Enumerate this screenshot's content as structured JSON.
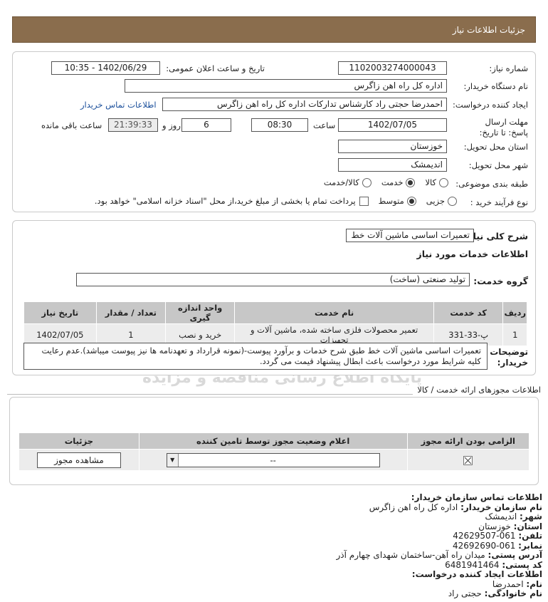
{
  "header": {
    "title": "جزئیات اطلاعات نیاز"
  },
  "need": {
    "number_label": "شماره نیاز:",
    "number": "1102003274000043",
    "announce_label": "تاریخ و ساعت اعلان عمومی:",
    "announce_value": "1402/06/29 - 10:35",
    "buyer_label": "نام دستگاه خریدار:",
    "buyer": "اداره کل راه اهن زاگرس",
    "creator_label": "ایجاد کننده درخواست:",
    "creator": "احمدرضا حجتی راد کارشناس تدارکات اداره کل راه اهن زاگرس",
    "contact_link": "اطلاعات تماس خریدار",
    "deadline_label": "مهلت ارسال پاسخ: تا تاریخ:",
    "deadline_date": "1402/07/05",
    "time_label": "ساعت",
    "deadline_time": "08:30",
    "days_value": "6",
    "days_label": "روز و",
    "remaining_time": "21:39:33",
    "remaining_label": "ساعت باقی مانده",
    "province_label": "استان محل تحویل:",
    "province": "خوزستان",
    "city_label": "شهر محل تحویل:",
    "city": "اندیمشک",
    "category_label": "طبقه بندی موضوعی:",
    "category_options": [
      "کالا",
      "خدمت",
      "کالا/خدمت"
    ],
    "category_selected": "خدمت",
    "process_label": "نوع فرآیند خرید :",
    "process_options": [
      "جزیی",
      "متوسط"
    ],
    "process_selected": "متوسط",
    "payment_note": "پرداخت تمام یا بخشی از مبلغ خرید،از محل \"اسناد خزانه اسلامی\" خواهد بود."
  },
  "summary": {
    "desc_label": "شرح کلی نیاز:",
    "desc": "تعمیرات اساسی ماشین آلات خط",
    "services_title": "اطلاعات خدمات مورد نیاز",
    "group_label": "گروه خدمت:",
    "group_value": "تولید صنعتی (ساخت)",
    "table": {
      "headers": [
        "ردیف",
        "کد خدمت",
        "نام خدمت",
        "واحد اندازه گیری",
        "تعداد / مقدار",
        "تاریخ نیاز"
      ],
      "rows": [
        [
          "1",
          "پ-33-331",
          "تعمیر محصولات فلزی ساخته شده، ماشین آلات و تجهیزات",
          "خرید و نصب",
          "1",
          "1402/07/05"
        ]
      ]
    },
    "buyer_notes_label": "توضیحات خریدار:",
    "buyer_notes": "تعمیرات اساسی ماشین آلات خط طبق شرح خدمات و برآورد پیوست-(نمونه قرارداد و تعهدنامه ها نیز پیوست میباشد).عدم رعایت کلیه شرایط مورد درخواست باعث ابطال پیشنهاد قیمت می گردد."
  },
  "licenses": {
    "section_label": "اطلاعات مجوزهای ارائه خدمت / کالا",
    "headers": [
      "الزامی بودن ارائه مجوز",
      "اعلام وضعیت مجوز توسط تامین کننده",
      "جزئیات"
    ],
    "select_value": "--",
    "view_button": "مشاهده مجوز"
  },
  "contact": {
    "title": "اطلاعات تماس سازمان خریدار:",
    "lines": [
      {
        "label": "نام سازمان خریدار:",
        "value": "اداره کل راه اهن زاگرس"
      },
      {
        "label": "شهر:",
        "value": "اندیمشک"
      },
      {
        "label": "استان:",
        "value": "خوزستان"
      },
      {
        "label": "تلفن:",
        "value": "061-42629507"
      },
      {
        "label": "نمابر:",
        "value": "061-42692690"
      },
      {
        "label": "آدرس پستی:",
        "value": "میدان راه آهن-ساختمان شهدای چهارم آذر"
      },
      {
        "label": "کد پستی:",
        "value": "6481941464"
      }
    ],
    "creator_title": "اطلاعات ایجاد کننده درخواست:",
    "creator_lines": [
      {
        "label": "نام:",
        "value": "احمدرضا"
      },
      {
        "label": "نام خانوادگی:",
        "value": "حجتی راد"
      }
    ]
  },
  "watermark": {
    "brand": "ParsNamadData",
    "slogan": "پایگاه اطلاع رسانی مناقصه و مزایده",
    "phone": "۰۲۱-۸۸۳۴۹۶۷۰-۵"
  },
  "colors": {
    "header_bg": "#8a6d4d",
    "link": "#1b4f9b",
    "table_header": "#c7c7c7",
    "table_cell": "#ececec"
  }
}
